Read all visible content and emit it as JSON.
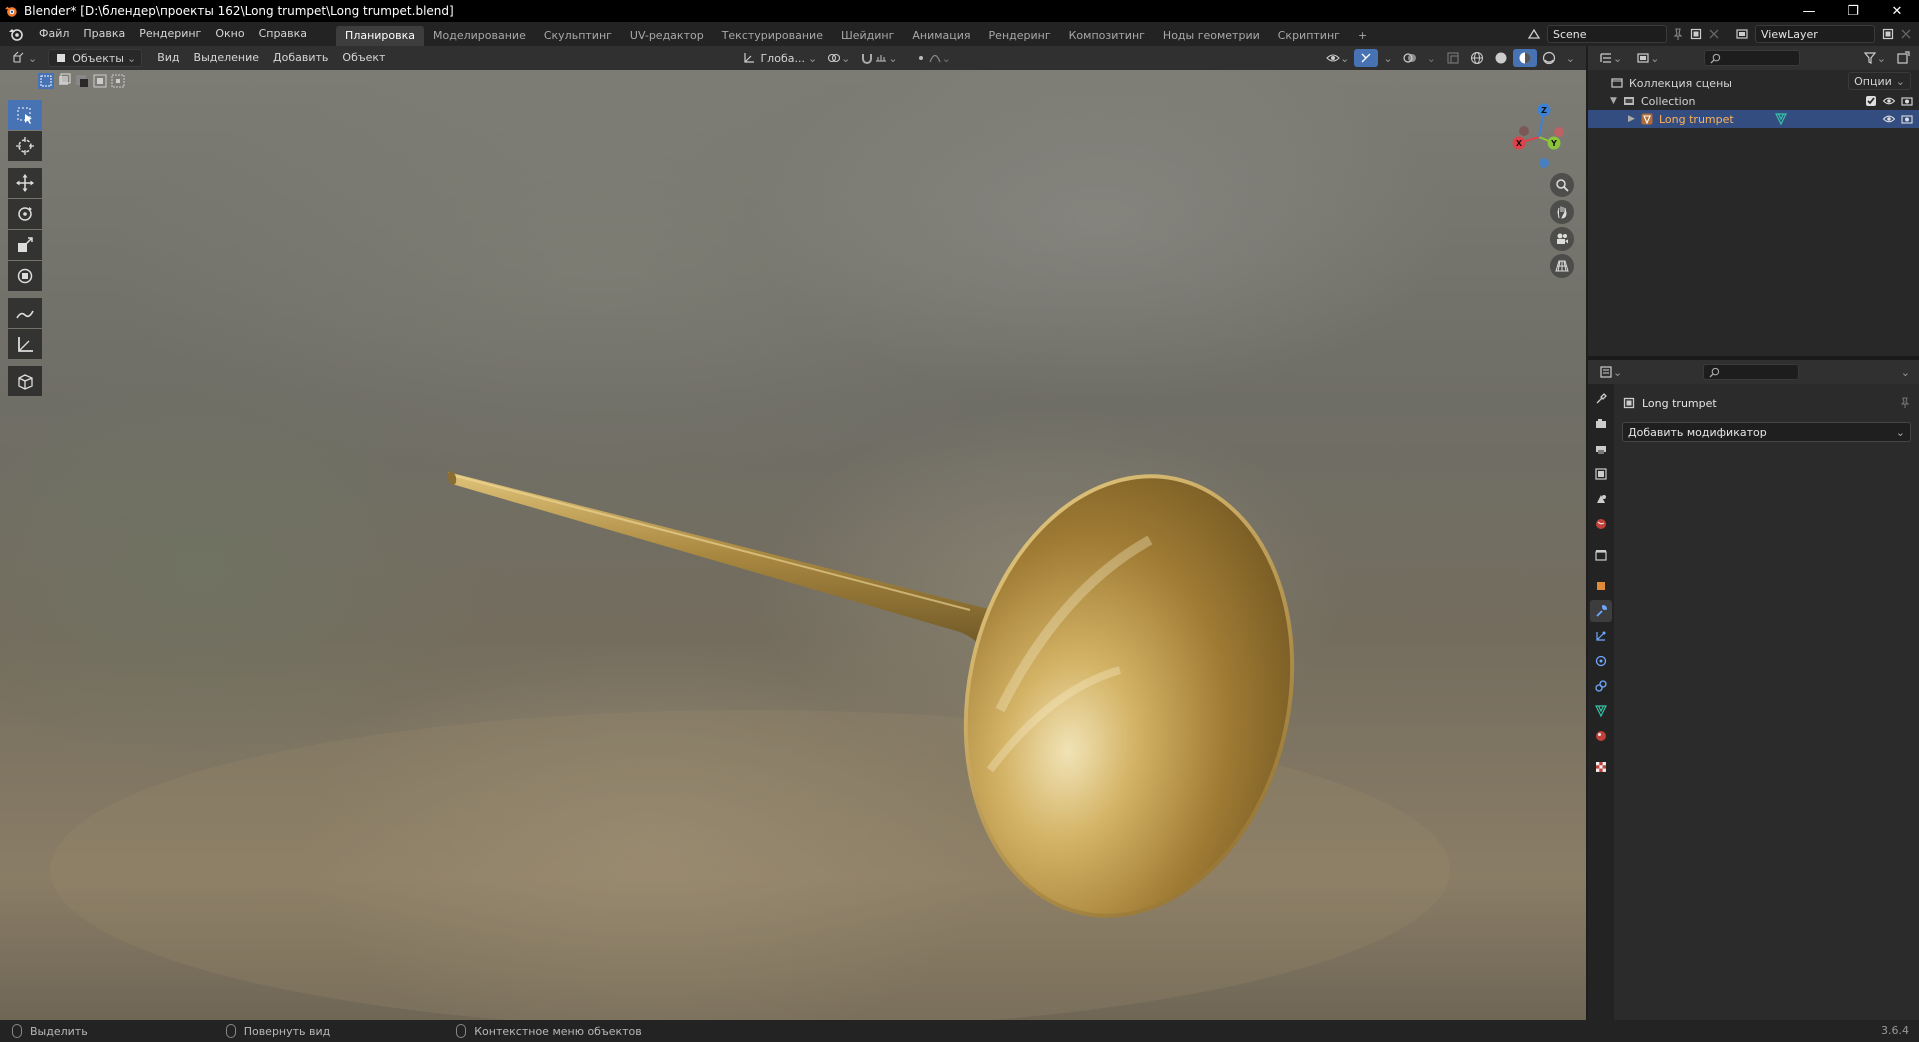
{
  "window": {
    "title": "Blender* [D:\\блендер\\проекты 162\\Long trumpet\\Long trumpet.blend]",
    "minimize": "—",
    "maximize": "❐",
    "close": "✕"
  },
  "menu": [
    "Файл",
    "Правка",
    "Рендеринг",
    "Окно",
    "Справка"
  ],
  "workspaces": [
    {
      "label": "Планировка",
      "active": true
    },
    {
      "label": "Моделирование",
      "active": false
    },
    {
      "label": "Скульптинг",
      "active": false
    },
    {
      "label": "UV-редактор",
      "active": false
    },
    {
      "label": "Текстурирование",
      "active": false
    },
    {
      "label": "Шейдинг",
      "active": false
    },
    {
      "label": "Анимация",
      "active": false
    },
    {
      "label": "Рендеринг",
      "active": false
    },
    {
      "label": "Композитинг",
      "active": false
    },
    {
      "label": "Ноды геометрии",
      "active": false
    },
    {
      "label": "Скриптинг",
      "active": false
    }
  ],
  "add_workspace": "+",
  "scene": {
    "name": "Scene",
    "view_layer": "ViewLayer"
  },
  "viewport_header": {
    "mode": "Объекты",
    "menus": [
      "Вид",
      "Выделение",
      "Добавить",
      "Объект"
    ],
    "orientation": "Глоба...",
    "options": "Опции"
  },
  "gizmo": {
    "x": "X",
    "y": "Y",
    "z": "Z"
  },
  "outliner": {
    "scene_collection": "Коллекция сцены",
    "collection": "Collection",
    "object": "Long trumpet"
  },
  "properties": {
    "object_name": "Long trumpet",
    "add_modifier": "Добавить модификатор"
  },
  "status": {
    "select": "Выделить",
    "rotate_view": "Повернуть вид",
    "context_menu": "Контекстное меню объектов",
    "version": "3.6.4"
  },
  "colors": {
    "accent_blue": "#4772b3",
    "selected_row": "#334d80",
    "axis_x": "#e0404a",
    "axis_y": "#8cc43c",
    "axis_z": "#3b82d6",
    "brass": "#c9a24a"
  }
}
